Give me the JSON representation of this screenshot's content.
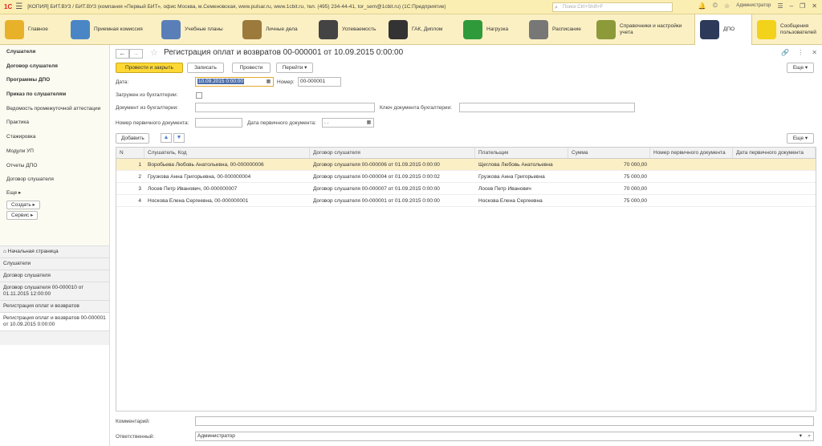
{
  "app": {
    "logo": "1С",
    "title": "[КОПИЯ] БИТ.ВУЗ / БИТ.ВУЗ (компания «Первый БИТ», офис Москва, м.Семеновская, www.pulsar.ru, www.1cbit.ru, тел. (495) 234-44-41, tor_sem@1cbit.ru) (1С:Предприятие)",
    "search_placeholder": "Поиск Ctrl+Shift+F",
    "user": "Администратор"
  },
  "sections": [
    {
      "label": "Главное",
      "color": "#e8b12a"
    },
    {
      "label": "Приемная комиссия",
      "color": "#4a86c5"
    },
    {
      "label": "Учебные планы",
      "color": "#5a7fb8"
    },
    {
      "label": "Личные дела",
      "color": "#9c7a3c"
    },
    {
      "label": "Успеваемость",
      "color": "#444444"
    },
    {
      "label": "ГАК, Диплом",
      "color": "#333333"
    },
    {
      "label": "Нагрузка",
      "color": "#2f9a3a"
    },
    {
      "label": "Расписание",
      "color": "#777777"
    },
    {
      "label": "Справочники и настройки учета",
      "color": "#8c9a3a"
    },
    {
      "label": "ДПО",
      "color": "#2d3a5a"
    },
    {
      "label": "Сообщения пользователей",
      "color": "#f2d21a"
    }
  ],
  "nav": {
    "items": [
      {
        "label": "Слушатели",
        "bold": true
      },
      {
        "label": "Договор слушателя",
        "bold": true
      },
      {
        "label": "Программы ДПО",
        "bold": true
      },
      {
        "label": "Приказ по слушателям",
        "bold": true
      },
      {
        "label": "Ведомость промежуточной аттестации",
        "bold": false
      },
      {
        "label": "Практика",
        "bold": false
      },
      {
        "label": "Стажировка",
        "bold": false
      },
      {
        "label": "Модули УП",
        "bold": false
      },
      {
        "label": "Отчеты ДПО",
        "bold": false
      },
      {
        "label": "Договор слушателя",
        "bold": false
      }
    ],
    "more": "Еще",
    "create": "Создать",
    "service": "Сервис"
  },
  "history": {
    "home": "Начальная страница",
    "items": [
      "Слушатели",
      "Договор слушателя",
      "Договор слушателя 00-000010 от 01.11.2015 12:00:00",
      "Регистрация оплат и возвратов",
      "Регистрация оплат и возвратов 00-000001 от 10.09.2015 0:00:00"
    ]
  },
  "doc": {
    "title": "Регистрация оплат и возвратов 00-000001 от 10.09.2015 0:00:00",
    "btn_post_close": "Провести и закрыть",
    "btn_save": "Записать",
    "btn_post": "Провести",
    "btn_goto": "Перейти",
    "btn_more": "Еще",
    "date_label": "Дата:",
    "date_value": "10.09.2015  0:00:00",
    "number_label": "Номер:",
    "number_value": "00-000001",
    "loaded_label": "Загружен из бухгалтерии:",
    "acc_doc_label": "Документ из бухгалтерии:",
    "acc_key_label": "Ключ документа бухгалтерии:",
    "prim_num_label": "Номер первичного документа:",
    "prim_date_label": "Дата первичного документа:",
    "prim_date_value": " .  .",
    "btn_add": "Добавить",
    "comment_label": "Комментарий:",
    "responsible_label": "Ответственный:",
    "responsible_value": "Администратор"
  },
  "table": {
    "columns": [
      "N",
      "Слушатель, Код",
      "Договор слушателя",
      "Плательщик",
      "Сумма",
      "Номер первичного документа",
      "Дата первичного документа"
    ],
    "rows": [
      {
        "n": "1",
        "student": "Воробьева Любовь Анатольевна, 00-000000006",
        "contract": "Договор слушателя 00-000006 от 01.09.2015 0:00:00",
        "payer": "Щеглова Любовь Анатольевна",
        "sum": "70 000,00"
      },
      {
        "n": "2",
        "student": "Грузкова Анна Григорьевна, 00-000000004",
        "contract": "Договор слушателя 00-000004 от 01.09.2015 0:00:02",
        "payer": "Грузкова Анна Григорьевна",
        "sum": "75 000,00"
      },
      {
        "n": "3",
        "student": "Лосев Петр Иванович, 00-000000007",
        "contract": "Договор слушателя 00-000007 от 01.09.2015 0:00:00",
        "payer": "Лосев Петр Иванович",
        "sum": "70 000,00"
      },
      {
        "n": "4",
        "student": "Носкова Елена Сергеевна, 00-000000001",
        "contract": "Договор слушателя 00-000001 от 01.09.2015 0:00:00",
        "payer": "Носкова Елена Сергеевна",
        "sum": "75 000,00"
      }
    ]
  }
}
